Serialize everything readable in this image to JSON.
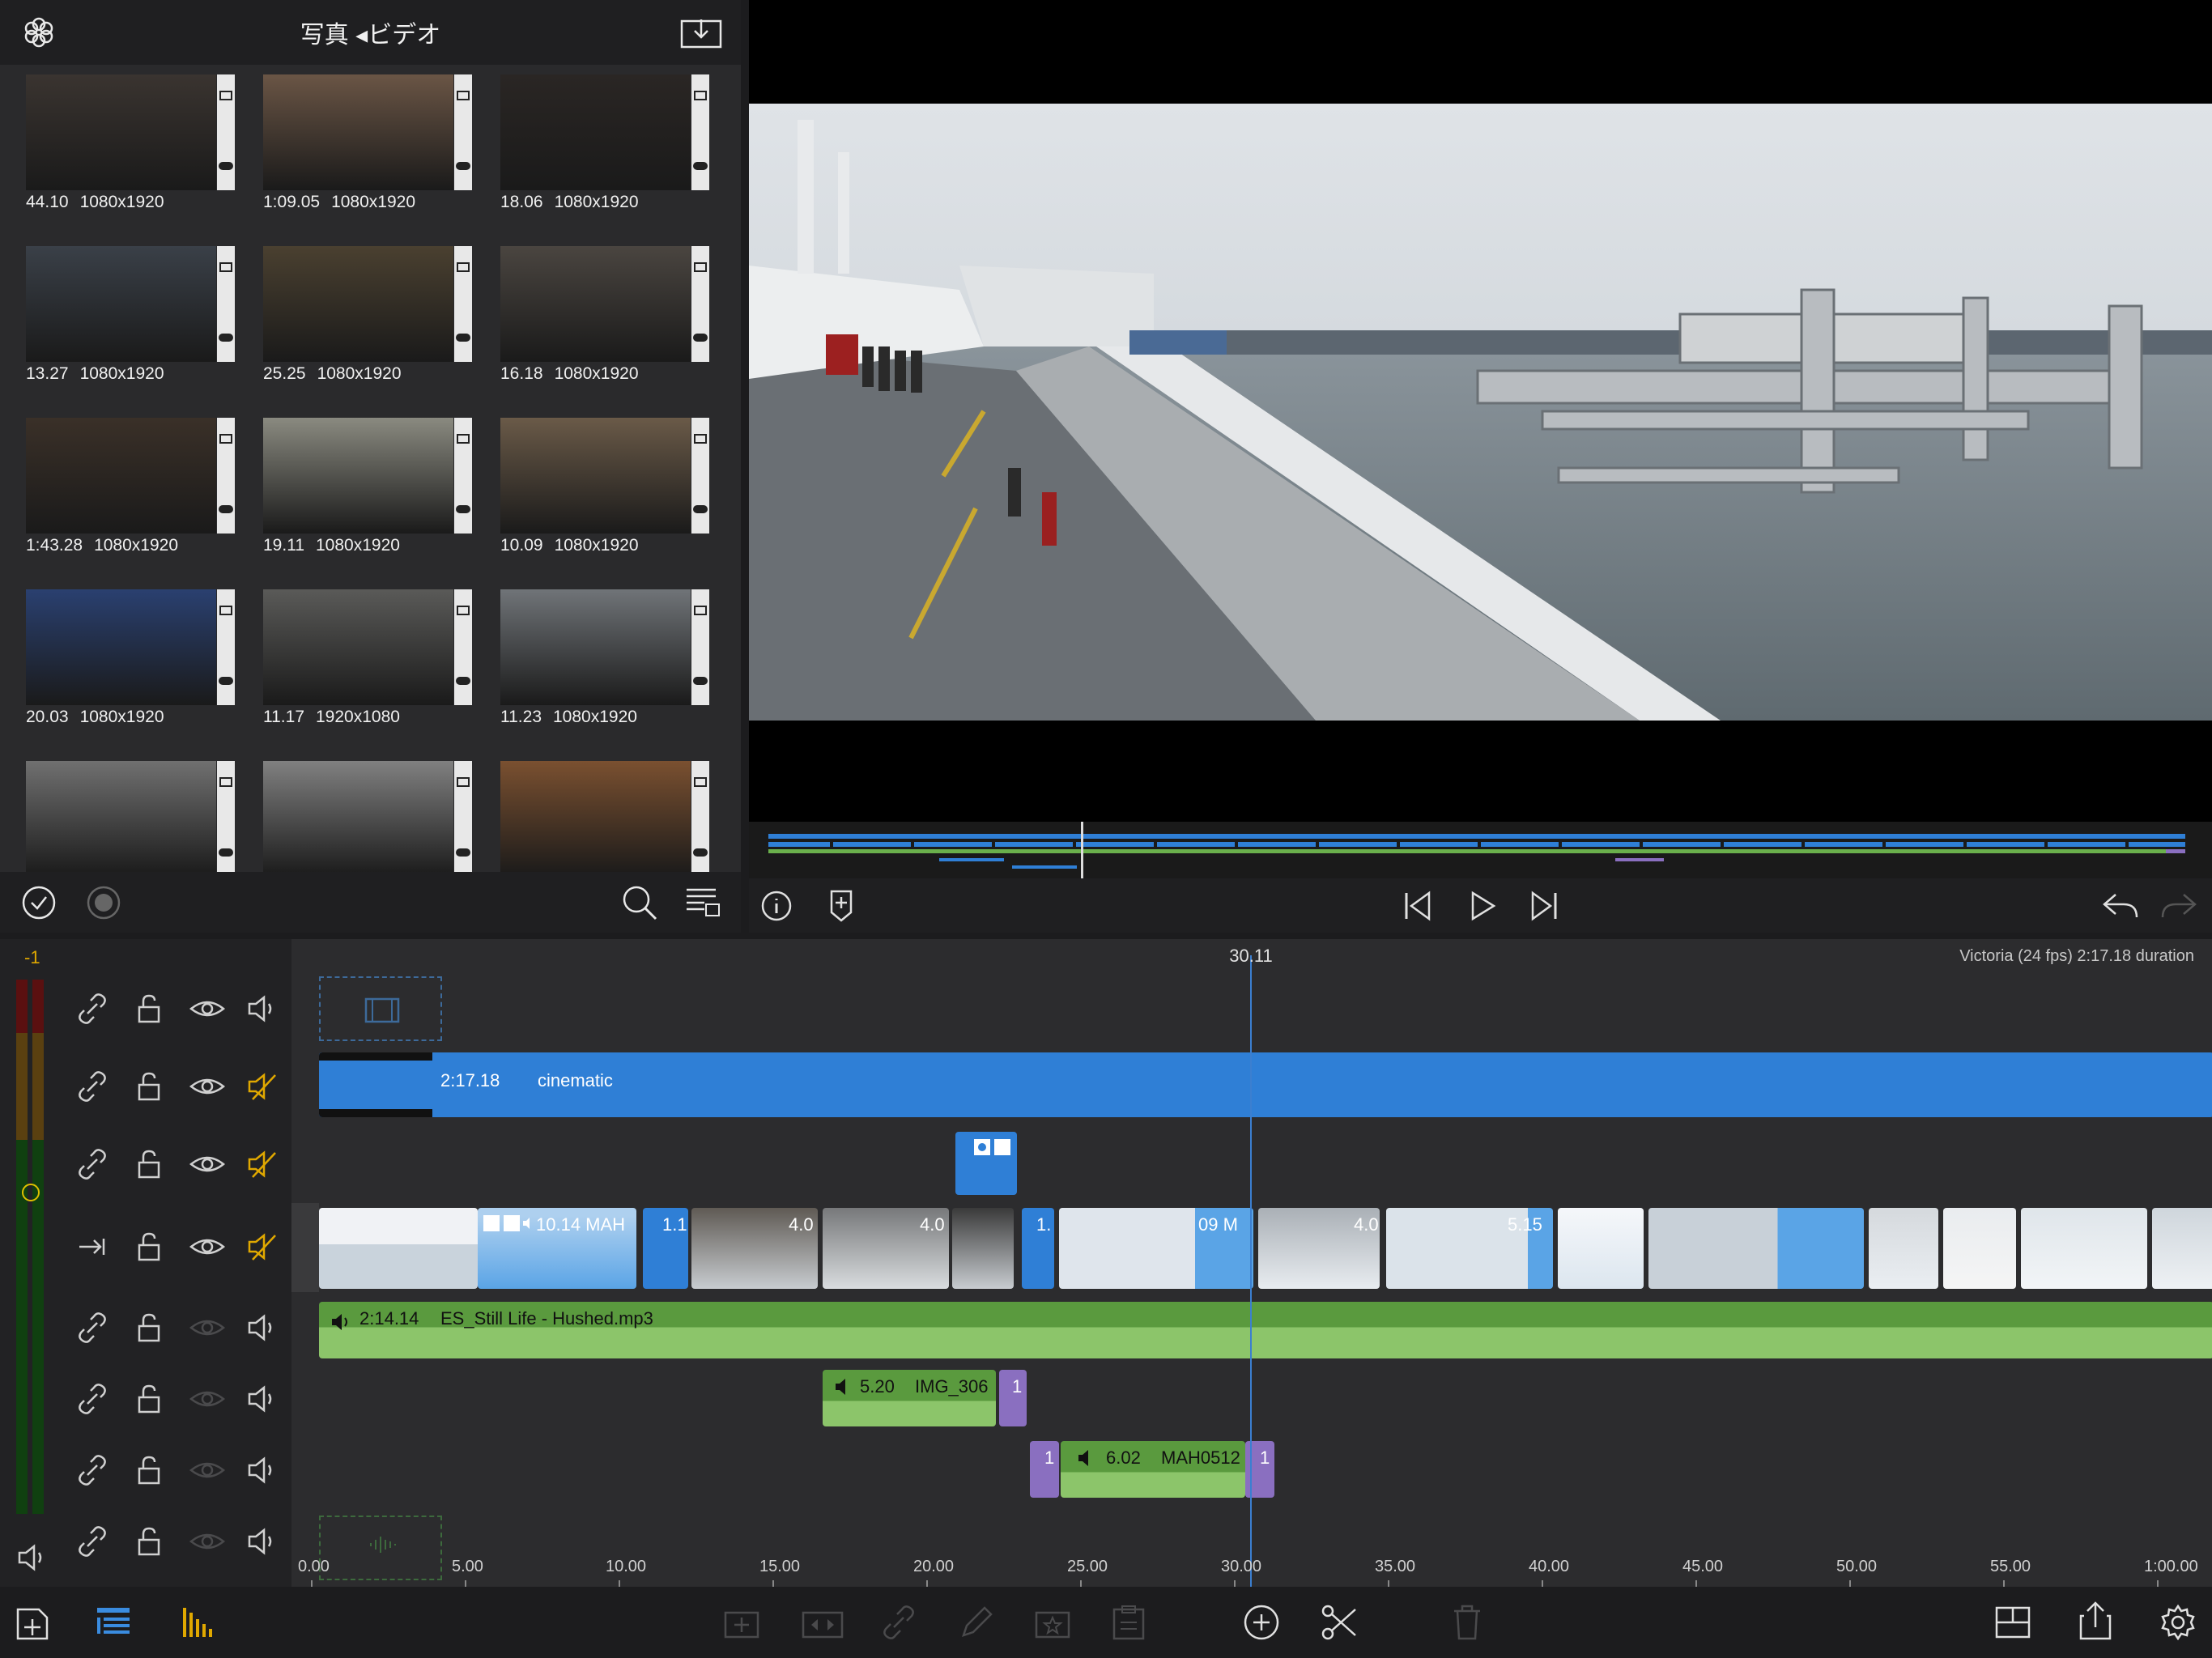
{
  "library": {
    "title": "写真 ◂ビデオ",
    "items": [
      {
        "duration": "44.10",
        "res": "1080x1920",
        "tint": "#3a3430"
      },
      {
        "duration": "1:09.05",
        "res": "1080x1920",
        "tint": "#6a5545"
      },
      {
        "duration": "18.06",
        "res": "1080x1920",
        "tint": "#2a2624"
      },
      {
        "duration": "13.27",
        "res": "1080x1920",
        "tint": "#3a4048"
      },
      {
        "duration": "25.25",
        "res": "1080x1920",
        "tint": "#4a4030"
      },
      {
        "duration": "16.18",
        "res": "1080x1920",
        "tint": "#4a4540"
      },
      {
        "duration": "1:43.28",
        "res": "1080x1920",
        "tint": "#3a3028"
      },
      {
        "duration": "19.11",
        "res": "1080x1920",
        "tint": "#8a8a80"
      },
      {
        "duration": "10.09",
        "res": "1080x1920",
        "tint": "#6a5a48"
      },
      {
        "duration": "20.03",
        "res": "1080x1920",
        "tint": "#2a4070"
      },
      {
        "duration": "11.17",
        "res": "1920x1080",
        "tint": "#5a5a58"
      },
      {
        "duration": "11.23",
        "res": "1080x1920",
        "tint": "#707478"
      },
      {
        "duration": "",
        "res": "",
        "tint": "#707070"
      },
      {
        "duration": "",
        "res": "",
        "tint": "#808080"
      },
      {
        "duration": "",
        "res": "",
        "tint": "#7a5030"
      }
    ]
  },
  "timeline": {
    "playhead_time": "30.11",
    "project_info": "Victoria (24 fps)  2:17.18 duration",
    "track_offset": "-1",
    "title_clip": {
      "duration": "2:17.18",
      "name": "cinematic"
    },
    "main_clips": [
      {
        "label": "10.14  MAH"
      },
      {
        "label": "1.1"
      },
      {
        "label": "4.0"
      },
      {
        "label": "4.0"
      },
      {
        "label": "1."
      },
      {
        "label": "09  M"
      },
      {
        "label": "4.0"
      },
      {
        "label": "5.15"
      }
    ],
    "music_clip": {
      "duration": "2:14.14",
      "name": "ES_Still Life - Hushed.mp3"
    },
    "audio_clip_1": {
      "duration": "5.20",
      "name": "IMG_306"
    },
    "audio_clip_2": {
      "duration": "6.02",
      "name": "MAH0512"
    },
    "transition_labels": [
      "1",
      "1",
      "1"
    ],
    "ruler_ticks": [
      "0.00",
      "5.00",
      "10.00",
      "15.00",
      "20.00",
      "25.00",
      "30.00",
      "35.00",
      "40.00",
      "45.00",
      "50.00",
      "55.00",
      "1:00.00"
    ]
  },
  "colors": {
    "accent_blue": "#2f7fd6",
    "audio_green": "#6ab04c",
    "transition_purple": "#8a6fc0",
    "muted_yellow": "#e0a800"
  }
}
